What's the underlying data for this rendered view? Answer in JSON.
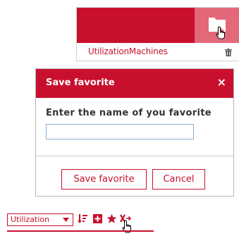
{
  "top_panel": {
    "item_name": "UtilizationMachines"
  },
  "dialog": {
    "title": "Save favorite",
    "close_glyph": "×",
    "prompt": "Enter the name of you favorite",
    "input_value": "",
    "save_label": "Save favorite",
    "cancel_label": "Cancel"
  },
  "toolbar": {
    "view_select_value": "Utilization"
  },
  "colors": {
    "accent": "#c8102e",
    "accent_light": "#e2687a",
    "input_border": "#8ab0d9"
  },
  "icons": [
    "folder-icon",
    "trash-icon",
    "close-icon",
    "chevron-down-icon",
    "sort-icon",
    "add-icon",
    "star-icon",
    "clear-filter-icon",
    "hand-cursor-icon"
  ]
}
